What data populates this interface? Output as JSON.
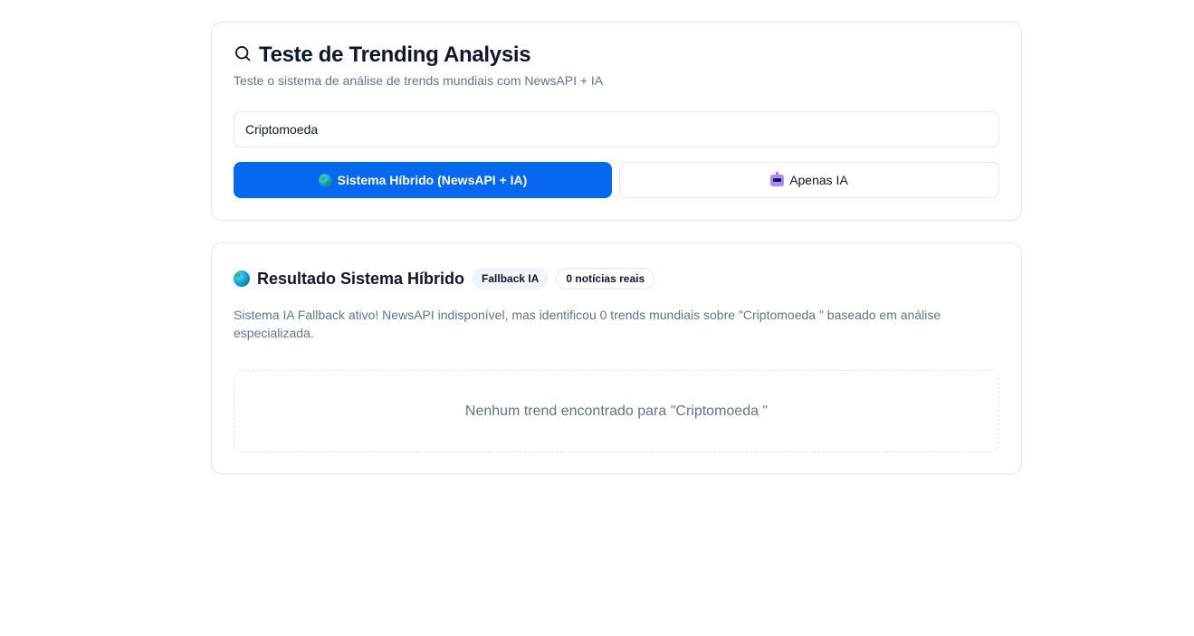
{
  "test_card": {
    "icon": "search-icon",
    "title": "Teste de Trending Analysis",
    "subtitle": "Teste o sistema de análise de trends mundiais com NewsAPI + IA",
    "query_value": "Criptomoeda",
    "hybrid_button_label": "Sistema Híbrido (NewsAPI + IA)",
    "hybrid_button_icon": "globe-icon",
    "ia_button_label": "Apenas IA",
    "ia_button_icon": "robot-icon",
    "accent_color": "#0568ef"
  },
  "result_card": {
    "icon": "globe-icon",
    "title": "Resultado Sistema Híbrido",
    "badges": [
      "Fallback IA",
      "0 notícias reais"
    ],
    "description": "Sistema IA Fallback ativo! NewsAPI indisponível, mas identificou 0 trends mundiais sobre \"Criptomoeda \" baseado em análise especializada.",
    "empty_message": "Nenhum trend encontrado para \"Criptomoeda \""
  }
}
